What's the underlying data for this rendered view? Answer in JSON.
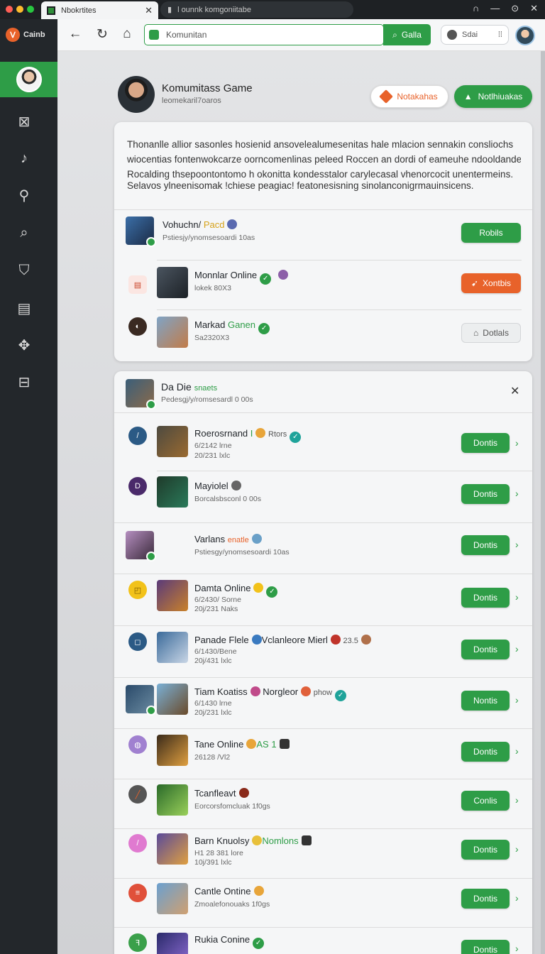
{
  "window": {
    "tab_active": "Nbokrtites",
    "tab_inactive": "l ounnk komgoniitabe",
    "controls": [
      "∩",
      "—",
      "⊙",
      "✕"
    ]
  },
  "sidebar": {
    "brand": "Cainb",
    "icons": [
      "inbox-icon",
      "joystick-icon",
      "wrench-icon",
      "search-icon",
      "cart-icon",
      "table-icon",
      "network-icon",
      "document-icon"
    ]
  },
  "toolbar": {
    "address_value": "Komunitan",
    "go_label": "Galla",
    "search_label": "Sdai"
  },
  "profile": {
    "name": "Komumitass Game",
    "sub": "leomekaril7oaros",
    "btn_notify": "Notakahas",
    "btn_notify2": "Notlhiuakas"
  },
  "card1": {
    "desc_lines": [
      "Thonanlle allior sasonles hosienid ansovelealumesenitas hale mlacion sennakin consliochs",
      "wiocentias fontenwokcarze oorncomenlinas peleed Roccen an dordi of eameuhe ndooldander",
      "Rocalding thsepoontontomo h okonitta kondesstalor carylecasal vhenorcocit unentermeins."
    ],
    "desc2": "Selavos ylneenisomak !chiese peagiac! featonesisning sinolanconigrmauinsicens.",
    "rows": [
      {
        "title": "Vohuchn/",
        "accent": "Pacd",
        "sub": "Pstiesjy/ynomsesoardi 10as",
        "button": "Robils"
      },
      {
        "title": "Monnlar Online",
        "accent": "",
        "sub": "lokek 80X3",
        "button": "Xontbis"
      },
      {
        "title": "Markad",
        "accent": "Ganen",
        "sub": "Sa2320X3",
        "button": "Dotlals"
      }
    ]
  },
  "card2": {
    "title": "Da Die",
    "title_accent": "snaets",
    "sub": "Pedesgj/y/romsesardl 0 00s",
    "rows": [
      {
        "title": "Roerosrnand",
        "accent": "I",
        "extra": "Rtors",
        "sub1": "6/2142 lrne",
        "sub2": "20/231 lxlc",
        "button": "Dontis"
      },
      {
        "title": "Mayiolel",
        "accent": "",
        "extra": "",
        "sub1": "Borcalsbsconl 0 00s",
        "sub2": "",
        "button": "Dontis"
      },
      {
        "title": "Varlans",
        "accent": "enatle",
        "extra": "",
        "sub1": "Pstiesgy/ynomsesoardi 10as",
        "sub2": "",
        "button": "Dontis"
      },
      {
        "title": "Damta Online",
        "accent": "",
        "extra": "",
        "sub1": "6/2430/ Sorne",
        "sub2": "20j/231 Naks",
        "button": "Dontis"
      },
      {
        "title": "Panade Flele",
        "accent": "Vclanleore Mierl",
        "extra": "23.5",
        "sub1": "6/1430/Bene",
        "sub2": "20j/431 lxlc",
        "button": "Dontis"
      },
      {
        "title": "Tiam Koatiss",
        "accent": "Norgleor",
        "extra": "phow",
        "sub1": "6/1430 lrne",
        "sub2": "20j/231 lxlc",
        "button": "Nontis"
      },
      {
        "title": "Tane Online",
        "accent": "AS 1",
        "extra": "",
        "sub1": "26128 /Vl2",
        "sub2": "",
        "button": "Dontis"
      },
      {
        "title": "Tcanfleavt",
        "accent": "",
        "extra": "",
        "sub1": "Eorcorsfomcluak 1f0gs",
        "sub2": "",
        "button": "Conlis"
      },
      {
        "title": "Barn Knuolsy",
        "accent": "Nomlons",
        "extra": "",
        "sub1": "H1 28 381 lore",
        "sub2": "10j/391 lxlc",
        "button": "Dontis"
      },
      {
        "title": "Cantle Ontine",
        "accent": "",
        "extra": "",
        "sub1": "Zmoalefonouaks 1f0gs",
        "sub2": "",
        "button": "Dontis"
      },
      {
        "title": "Rukia Conine",
        "accent": "",
        "extra": "",
        "sub1": "",
        "sub2": "",
        "button": "Dontis"
      }
    ]
  },
  "colors": {
    "accent_green": "#2e9d47",
    "accent_orange": "#e8622a",
    "sidebar_bg": "#23272b"
  }
}
